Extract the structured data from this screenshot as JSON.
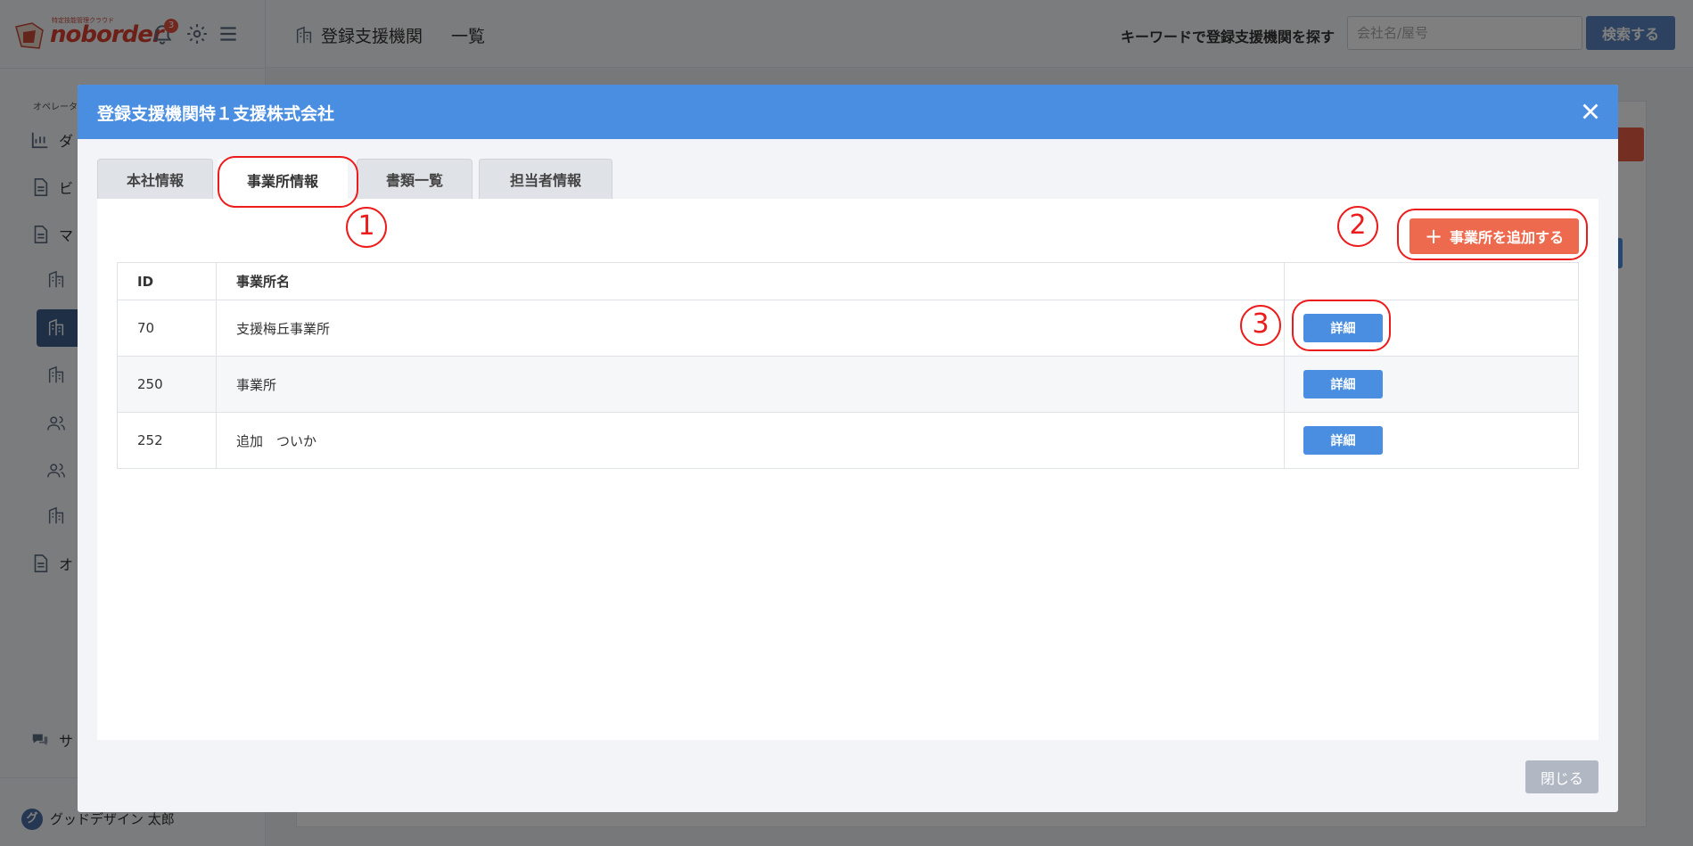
{
  "app": {
    "brand_name": "noborder",
    "brand_tagline": "特定技能管理クラウド",
    "notification_count": "3"
  },
  "sidebar": {
    "section_label": "オペレータ",
    "items": [
      {
        "label": "ダ",
        "icon": "chart-icon"
      },
      {
        "label": "ビ",
        "icon": "document-icon"
      },
      {
        "label": "マ",
        "icon": "document-icon"
      },
      {
        "label": "オ",
        "icon": "document-icon"
      },
      {
        "label": "サ",
        "icon": "chat-icon"
      }
    ],
    "user": {
      "avatar": "グ",
      "name": "グッドデザイン 太郎"
    }
  },
  "topbar": {
    "title": "登録支援機関",
    "subtitle": "一覧",
    "search_label": "キーワードで登録支援機関を探す",
    "search_placeholder": "会社名/屋号",
    "search_button": "検索する"
  },
  "modal": {
    "title": "登録支援機関特１支援株式会社",
    "tabs": [
      {
        "label": "本社情報",
        "active": false
      },
      {
        "label": "事業所情報",
        "active": true
      },
      {
        "label": "書類一覧",
        "active": false
      },
      {
        "label": "担当者情報",
        "active": false
      }
    ],
    "add_button": "事業所を追加する",
    "table": {
      "headers": {
        "id": "ID",
        "name": "事業所名"
      },
      "rows": [
        {
          "id": "70",
          "name": "支援梅丘事業所",
          "action": "詳細"
        },
        {
          "id": "250",
          "name": "事業所",
          "action": "詳細"
        },
        {
          "id": "252",
          "name": "追加　ついか",
          "action": "詳細"
        }
      ]
    },
    "close_button": "閉じる"
  },
  "annotations": {
    "one": "1",
    "two": "2",
    "three": "3"
  },
  "colors": {
    "header_blue": "#4a8ee2",
    "add_orange": "#ee6a4e",
    "annotation_red": "#ec1c1c",
    "brand_red": "#d9412f"
  }
}
